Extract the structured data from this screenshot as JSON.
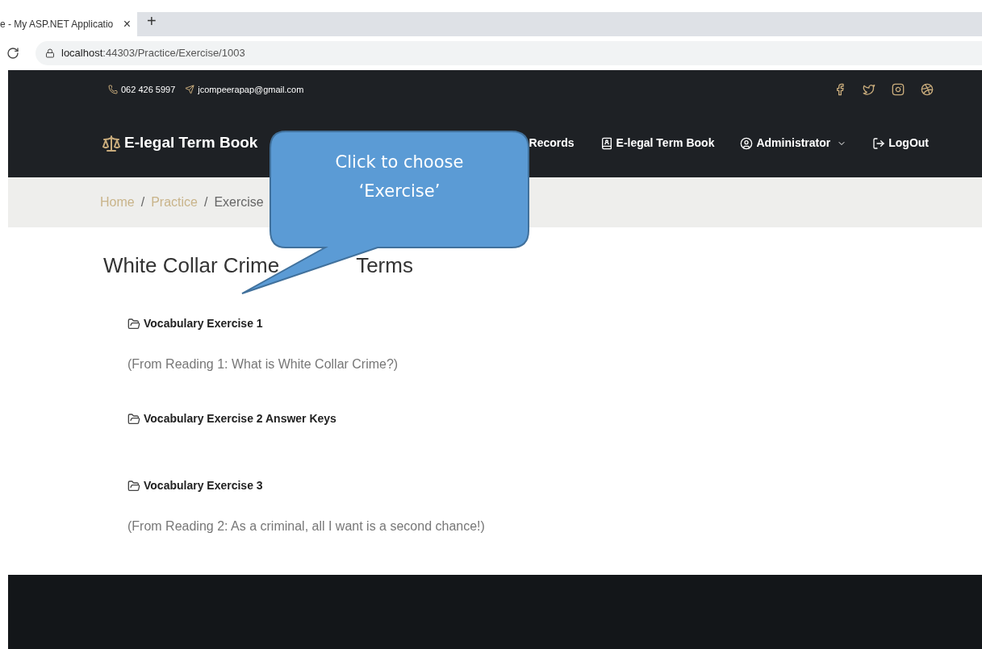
{
  "browser": {
    "tab_title": "e - My ASP.NET Applicatio",
    "tab_close": "×",
    "new_tab": "+",
    "url_host": "localhost",
    "url_path": ":44303/Practice/Exercise/1003"
  },
  "topbar": {
    "phone": "062 426 5997",
    "email": "jcompeerapap@gmail.com"
  },
  "navbar": {
    "brand": "E-legal Term Book",
    "items": [
      {
        "label": "Records",
        "kind": "plain"
      },
      {
        "label": "E-legal Term Book",
        "kind": "book"
      },
      {
        "label": "Administrator",
        "kind": "user"
      },
      {
        "label": "LogOut",
        "kind": "logout"
      }
    ]
  },
  "breadcrumb_separator": "/",
  "breadcrumb": [
    {
      "label": "Home",
      "current": false
    },
    {
      "label": "Practice",
      "current": false
    },
    {
      "label": "Exercise",
      "current": true
    }
  ],
  "heading": [
    "White Collar Crime",
    "Terms"
  ],
  "exercises": [
    {
      "title": "Vocabulary Exercise 1",
      "note": "(From Reading 1: What is White Collar Crime?)"
    },
    {
      "title": "Vocabulary Exercise 2 Answer Keys"
    },
    {
      "title": "Vocabulary Exercise 3",
      "note": "(From Reading 2: As a criminal, all I want is a second chance!)"
    }
  ],
  "callout": {
    "lines": [
      "Click to choose",
      "‘Exercise’"
    ]
  }
}
